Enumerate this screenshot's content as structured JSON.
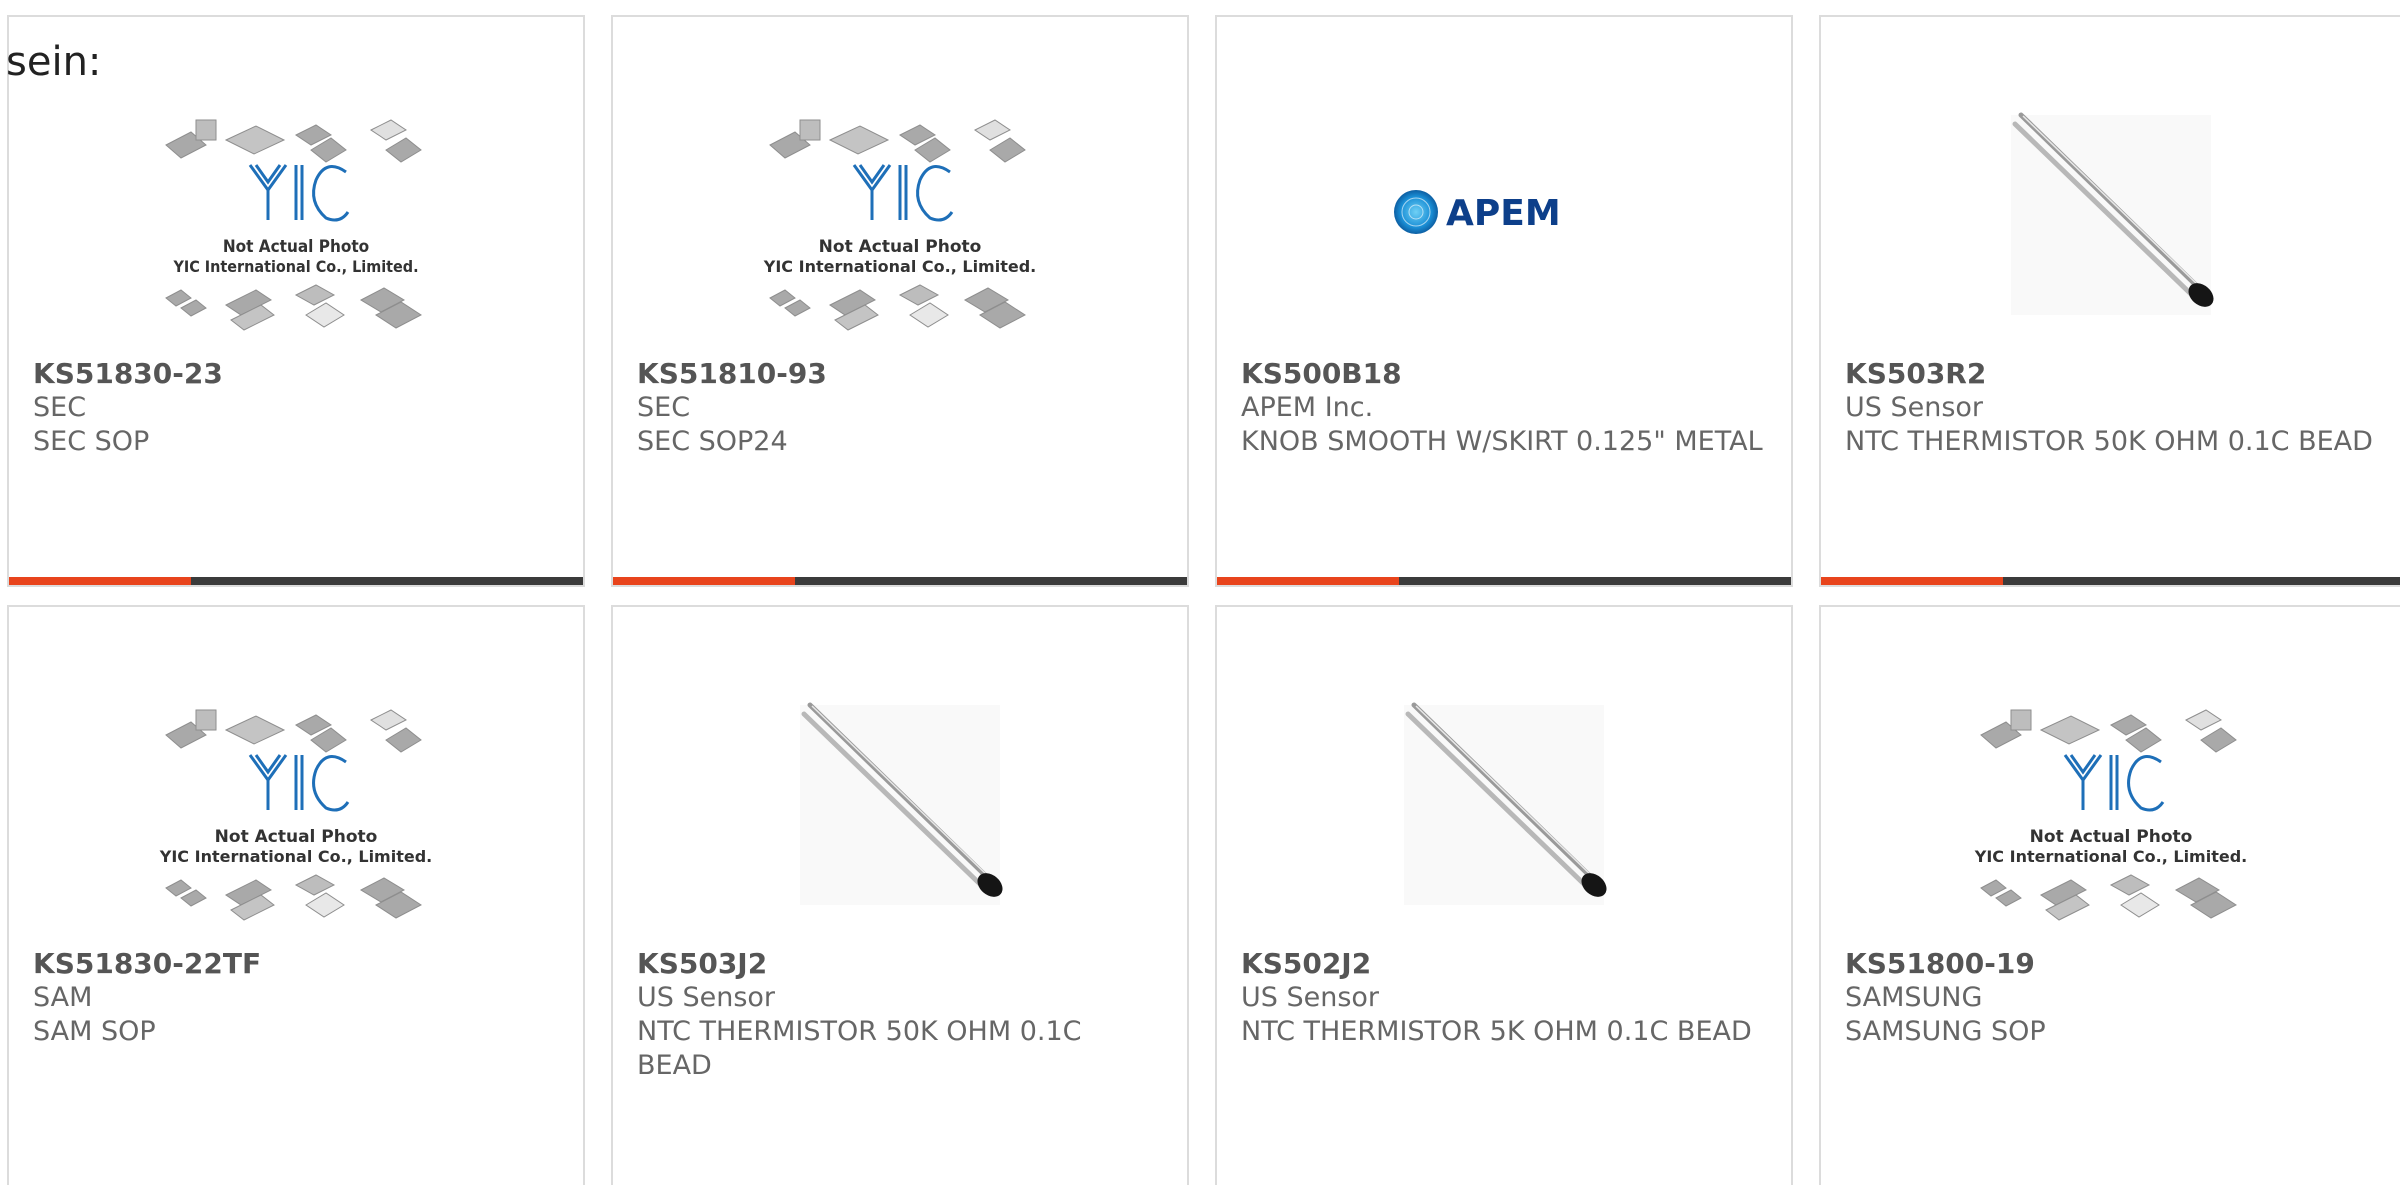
{
  "intro_text": "sein:",
  "accent_color": "#e8441c",
  "products": [
    {
      "part": "KS51830-23",
      "manufacturer": "SEC",
      "description": "SEC SOP",
      "image": "yic-placeholder",
      "caption1": "Not Actual Photo",
      "caption2": "YIC International Co., Limited."
    },
    {
      "part": "KS51810-93",
      "manufacturer": "SEC",
      "description": "SEC SOP24",
      "image": "yic-placeholder",
      "caption1": "Not Actual Photo",
      "caption2": "YIC International Co., Limited."
    },
    {
      "part": "KS500B18",
      "manufacturer": "APEM Inc.",
      "description": "KNOB SMOOTH W/SKIRT 0.125\" METAL",
      "image": "apem-logo",
      "logo_text": "APEM"
    },
    {
      "part": "KS503R2",
      "manufacturer": "US Sensor",
      "description": "NTC THERMISTOR 50K OHM 0.1C BEAD",
      "image": "thermistor"
    },
    {
      "part": "KS51830-22TF",
      "manufacturer": "SAM",
      "description": "SAM SOP",
      "image": "yic-placeholder",
      "caption1": "Not Actual Photo",
      "caption2": "YIC International Co., Limited."
    },
    {
      "part": "KS503J2",
      "manufacturer": "US Sensor",
      "description": "NTC THERMISTOR 50K OHM 0.1C BEAD",
      "image": "thermistor"
    },
    {
      "part": "KS502J2",
      "manufacturer": "US Sensor",
      "description": "NTC THERMISTOR 5K OHM 0.1C BEAD",
      "image": "thermistor"
    },
    {
      "part": "KS51800-19",
      "manufacturer": "SAMSUNG",
      "description": "SAMSUNG SOP",
      "image": "yic-placeholder",
      "caption1": "Not Actual Photo",
      "caption2": "YIC International Co., Limited."
    }
  ]
}
